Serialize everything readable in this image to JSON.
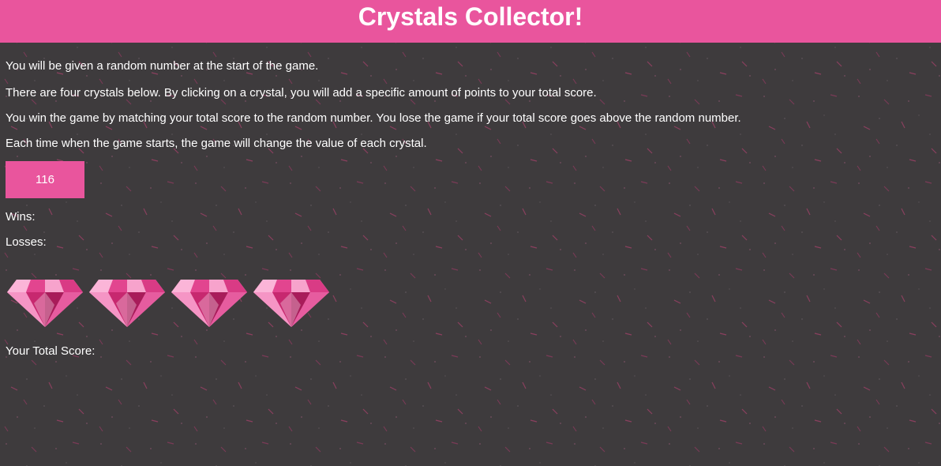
{
  "header": {
    "title": "Crystals Collector!"
  },
  "instructions": [
    "You will be given a random number at the start of the game.",
    "There are four crystals below. By clicking on a crystal, you will add a specific amount of points to your total score.",
    "You win the game by matching your total score to the random number. You lose the game if your total score goes above the random number.",
    "Each time when the game starts, the game will change the value of each crystal."
  ],
  "game": {
    "random_number": "116",
    "wins_label": "Wins:",
    "losses_label": "Losses:",
    "total_score_label": "Your Total Score:"
  },
  "crystals": [
    {
      "icon": "pink-diamond-icon"
    },
    {
      "icon": "pink-diamond-icon"
    },
    {
      "icon": "pink-diamond-icon"
    },
    {
      "icon": "pink-diamond-icon"
    }
  ],
  "colors": {
    "accent": "#e9559d",
    "background": "#3e3b3d",
    "text": "#ffffff"
  }
}
